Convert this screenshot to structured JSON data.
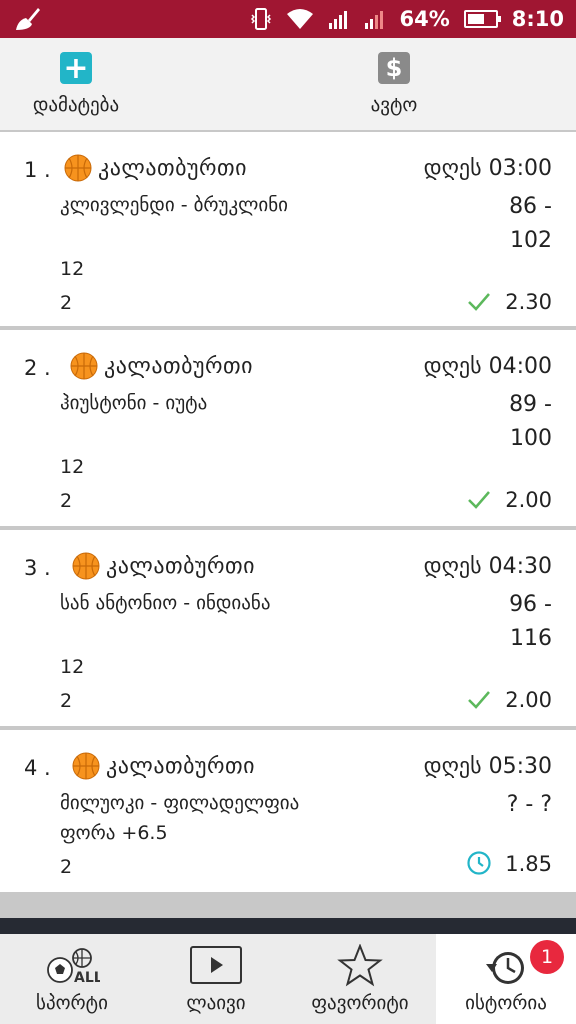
{
  "status_bar": {
    "battery": "64%",
    "time": "8:10",
    "battery_level": 0.64,
    "icons": [
      "broom-icon",
      "vibrate-icon",
      "wifi-icon",
      "signal-icon",
      "signal-icon",
      "battery-icon"
    ]
  },
  "toolbar": {
    "add_label": "დამატება",
    "auto_label": "ავტო",
    "add_icon": "plus-icon",
    "auto_icon": "dollar-icon",
    "add_glyph": "+",
    "auto_glyph": "$"
  },
  "bets": [
    {
      "number": "1 .",
      "sport": "კალათბურთი",
      "time": "დღეს 03:00",
      "teams": "კლივლენდი - ბრუკლინი",
      "score_line1": "86 -",
      "score_line2": "102",
      "market": "12",
      "selection": "2",
      "status": "won",
      "odds": "2.30"
    },
    {
      "number": "2 .",
      "sport": "კალათბურთი",
      "time": "დღეს 04:00",
      "teams": "ჰიუსტონი - იუტა",
      "score_line1": "89 -",
      "score_line2": "100",
      "market": "12",
      "selection": "2",
      "status": "won",
      "odds": "2.00"
    },
    {
      "number": "3 .",
      "sport": "კალათბურთი",
      "time": "დღეს 04:30",
      "teams": "სან ანტონიო - ინდიანა",
      "score_line1": "96 -",
      "score_line2": "116",
      "market": "12",
      "selection": "2",
      "status": "won",
      "odds": "2.00"
    },
    {
      "number": "4 .",
      "sport": "კალათბურთი",
      "time": "დღეს 05:30",
      "teams": "მილუოკი - ფილადელფია",
      "score_line1": "? - ?",
      "score_line2": "",
      "market": "ფორა +6.5",
      "selection": "2",
      "status": "pending",
      "odds": "1.85"
    }
  ],
  "bottom_nav": {
    "sports": "სპორტი",
    "sports_all": "ALL",
    "live": "ლაივი",
    "favorites": "ფავორიტი",
    "history": "ისტორია",
    "history_badge": "1"
  },
  "colors": {
    "status_bar": "#a01632",
    "accent_teal": "#22b5c8",
    "check_green": "#5cb85c",
    "badge_red": "#e8283e",
    "basketball_orange": "#f7931e"
  }
}
